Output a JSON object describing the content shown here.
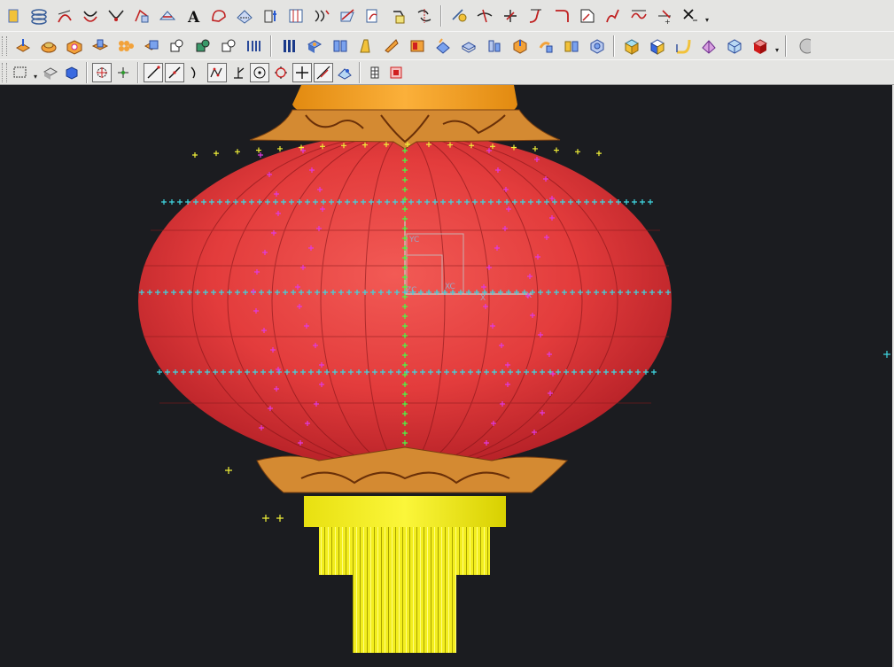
{
  "app": {
    "kind": "3D CAD modeling application"
  },
  "toolbars": {
    "row1": {
      "tools": [
        "point-tool",
        "helix-tool",
        "law-curve-tool",
        "offset-curve-tool",
        "bridge-curve-tool",
        "extract-curve-tool",
        "project-curve-tool",
        "text-tool",
        "section-curve-tool",
        "wrap-curve-tool",
        "extrude-curve-tool",
        "isoparametric-curve-tool",
        "combined-curve-tool",
        "intersect-curve-tool",
        "edit-curve-tool",
        "edit-spline-tool",
        "divide-curve-tool",
        "trim-curve-tool",
        "trim-corner-tool",
        "extend-curve-tool",
        "fillet-curve-tool",
        "chamfer-curve-tool",
        "length-curve-tool",
        "smooth-curve-tool",
        "edit-parameters-tool",
        "delete-curve-tool"
      ],
      "more_label": "▾"
    },
    "row2": {
      "tools": [
        "extrude-tool",
        "revolve-tool",
        "hole-tool",
        "boss-tool",
        "pocket-tool",
        "pad-tool",
        "unite-tool",
        "subtract-tool",
        "intersect-tool",
        "sweep-tool",
        "rib-tool",
        "emboss-tool",
        "pattern-tool",
        "mirror-tool",
        "draft-tool",
        "offset-face-tool",
        "thicken-tool",
        "shell-tool",
        "blend-tool",
        "chamfer-tool",
        "trim-body-tool",
        "split-body-tool",
        "cylinder-tool",
        "block-tool",
        "cone-tool",
        "sphere-tool",
        "face-blend-tool",
        "bounded-plane-tool",
        "n-sided-surface-tool",
        "through-curves-tool",
        "ruled-surface-tool",
        "sew-tool",
        "box-tool"
      ],
      "more_label": "▾"
    },
    "row3": {
      "tools": [
        "box-select-tool",
        "select-body-tool",
        "select-face-tool",
        "snap-existing-point",
        "snap-endpoint",
        "snap-midpoint",
        "snap-control-point",
        "snap-intersection",
        "snap-arc-center",
        "snap-quadrant",
        "snap-point-on-curve",
        "snap-tangent",
        "snap-surface-point",
        "snap-bounded-grid",
        "snap-toggle"
      ]
    }
  },
  "viewport": {
    "background": "#1b1c20",
    "wcs_labels": {
      "yc": "YC",
      "zc": "ZC",
      "xc": "XC",
      "x": "X"
    },
    "colors": {
      "lantern_body": "#e53b3b",
      "lantern_dark": "#b01e23",
      "cap_orange": "#f7a024",
      "ornament_gold": "#d48a32",
      "tassel_yellow": "#f1ed1b",
      "point_cyan": "#3fd6e0",
      "point_magenta": "#e03ae0",
      "point_green": "#46ff46",
      "point_yellow": "#f0ef38"
    }
  }
}
